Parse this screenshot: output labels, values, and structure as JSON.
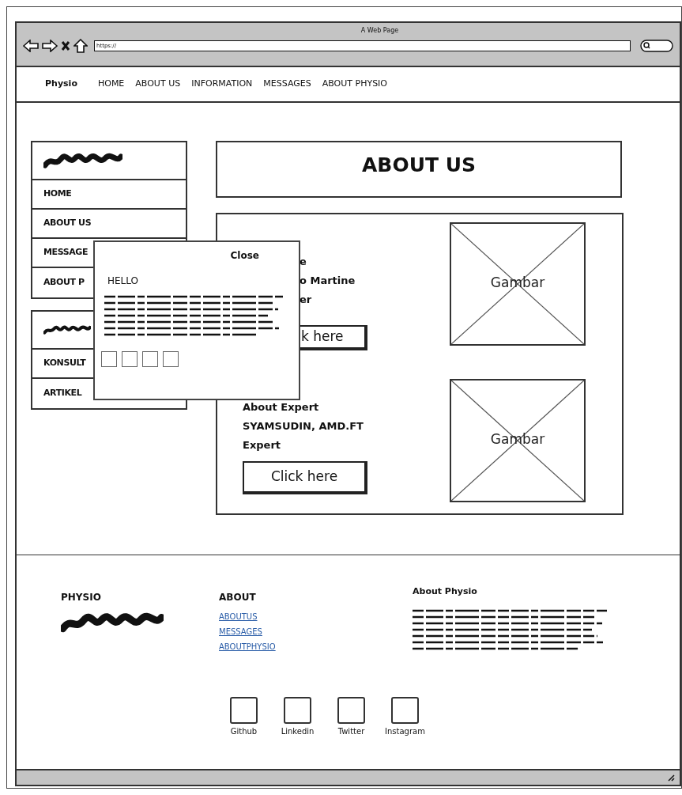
{
  "browser": {
    "title": "A Web Page",
    "url": "https://"
  },
  "navbar": {
    "brand": "Physio",
    "links": [
      "HOME",
      "ABOUT US",
      "INFORMATION",
      "MESSAGES",
      "ABOUT PHYSIO"
    ]
  },
  "sidebar": {
    "groups": [
      {
        "items": [
          "HOME",
          "ABOUT US",
          "MESSAGE",
          "ABOUT P"
        ]
      },
      {
        "items": [
          "KONSULT",
          "ARTIKEL"
        ]
      }
    ]
  },
  "header": {
    "title": "ABOUT US"
  },
  "profiles": [
    {
      "kind": "covered",
      "lines": [
        "e",
        "o Martine",
        "er"
      ],
      "button": "k here",
      "image": "Gambar"
    },
    {
      "kind": "full",
      "lines": [
        "About Expert",
        "SYAMSUDIN, AMD.FT",
        "Expert"
      ],
      "button": "Click here",
      "image": "Gambar"
    }
  ],
  "popup": {
    "close": "Close",
    "title": "HELLO",
    "tiles": [
      {
        "kind": "square"
      },
      {
        "kind": "square"
      },
      {
        "kind": "square"
      },
      {
        "kind": "square"
      }
    ]
  },
  "footer": {
    "brand": "PHYSIO",
    "about_title": "ABOUT",
    "links": [
      "ABOUTUS",
      "MESSAGES",
      "ABOUTPHYSIO"
    ],
    "about_physio_title": "About Physio",
    "social": [
      "Github",
      "Linkedin",
      "Twitter",
      "Instagram"
    ]
  }
}
